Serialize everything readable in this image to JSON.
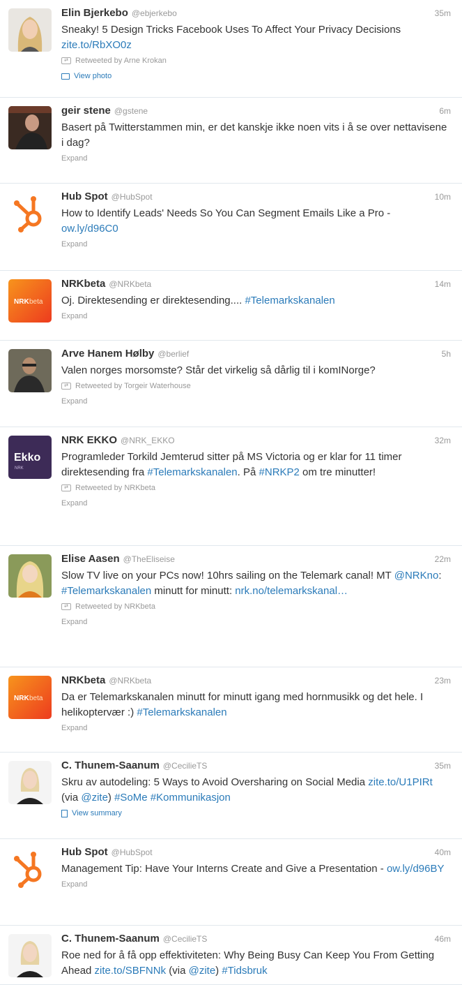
{
  "tweets": [
    {
      "name": "Elin Bjerkebo",
      "handle": "@ebjerkebo",
      "time": "35m",
      "avatar": "woman-blonde",
      "segments": [
        {
          "t": "Sneaky! 5 Design Tricks Facebook Uses To Affect Your Privacy Decisions ",
          "k": "text"
        },
        {
          "t": "zite.to/RbXO0z",
          "k": "link"
        }
      ],
      "retweeted_by": "Retweeted by Arne Krokan",
      "action": "View photo",
      "action_type": "photo"
    },
    {
      "name": "geir stene",
      "handle": "@gstene",
      "time": "6m",
      "avatar": "man-dark",
      "segments": [
        {
          "t": "Basert på Twitterstammen min, er det kanskje ikke noen vits i å se over nettavisene i dag?",
          "k": "text"
        }
      ],
      "action": "Expand",
      "action_type": "expand"
    },
    {
      "name": "Hub Spot",
      "handle": "@HubSpot",
      "time": "10m",
      "avatar": "hubspot",
      "segments": [
        {
          "t": "How to Identify Leads' Needs So You Can Segment Emails Like a Pro - ",
          "k": "text"
        },
        {
          "t": "ow.ly/d96C0",
          "k": "link"
        }
      ],
      "action": "Expand",
      "action_type": "expand"
    },
    {
      "name": "NRKbeta",
      "handle": "@NRKbeta",
      "time": "14m",
      "avatar": "nrkbeta",
      "segments": [
        {
          "t": "Oj. Direktesending er direktesending.... ",
          "k": "text"
        },
        {
          "t": "#Telemarkskanalen",
          "k": "tag"
        }
      ],
      "action": "Expand",
      "action_type": "expand"
    },
    {
      "name": "Arve Hanem Hølby",
      "handle": "@berlief",
      "time": "5h",
      "avatar": "man-glasses",
      "segments": [
        {
          "t": "Valen norges morsomste? Står det virkelig så dårlig til i komINorge?",
          "k": "text"
        }
      ],
      "retweeted_by": "Retweeted by Torgeir Waterhouse",
      "action": "Expand",
      "action_type": "expand"
    },
    {
      "name": "NRK EKKO",
      "handle": "@NRK_EKKO",
      "time": "32m",
      "avatar": "ekko",
      "segments": [
        {
          "t": "Programleder Torkild Jemterud sitter på MS Victoria og er klar for 11 timer direktesending fra ",
          "k": "text"
        },
        {
          "t": "#Telemarkskanalen",
          "k": "tag"
        },
        {
          "t": ". På ",
          "k": "text"
        },
        {
          "t": "#NRKP2",
          "k": "tag"
        },
        {
          "t": " om tre minutter!",
          "k": "text"
        }
      ],
      "retweeted_by": "Retweeted by NRKbeta",
      "action": "Expand",
      "action_type": "expand"
    },
    {
      "name": "Elise Aasen",
      "handle": "@TheEliseise",
      "time": "22m",
      "avatar": "woman-light",
      "segments": [
        {
          "t": "Slow TV live on your PCs now! 10hrs sailing on the Telemark canal! MT ",
          "k": "text"
        },
        {
          "t": "@NRKno",
          "k": "link"
        },
        {
          "t": ": ",
          "k": "text"
        },
        {
          "t": "#Telemarkskanalen",
          "k": "tag"
        },
        {
          "t": " minutt for minutt: ",
          "k": "text"
        },
        {
          "t": "nrk.no/telemarkskanal…",
          "k": "link"
        }
      ],
      "retweeted_by": "Retweeted by NRKbeta",
      "action": "Expand",
      "action_type": "expand"
    },
    {
      "name": "NRKbeta",
      "handle": "@NRKbeta",
      "time": "23m",
      "avatar": "nrkbeta",
      "segments": [
        {
          "t": "Da er Telemarkskanalen minutt for minutt igang med hornmusikk og det hele. I helikoptervær :) ",
          "k": "text"
        },
        {
          "t": "#Telemarkskanalen",
          "k": "tag"
        }
      ],
      "action": "Expand",
      "action_type": "expand"
    },
    {
      "name": "C. Thunem-Saanum",
      "handle": "@CecilieTS",
      "time": "35m",
      "avatar": "woman-blonde2",
      "segments": [
        {
          "t": "Skru av autodeling: 5 Ways to Avoid Oversharing on Social Media ",
          "k": "text"
        },
        {
          "t": "zite.to/U1PIRt",
          "k": "link"
        },
        {
          "t": " (via ",
          "k": "text"
        },
        {
          "t": "@zite",
          "k": "link"
        },
        {
          "t": ") ",
          "k": "text"
        },
        {
          "t": "#SoMe",
          "k": "tag"
        },
        {
          "t": " ",
          "k": "text"
        },
        {
          "t": "#Kommunikasjon",
          "k": "tag"
        }
      ],
      "action": "View summary",
      "action_type": "summary"
    },
    {
      "name": "Hub Spot",
      "handle": "@HubSpot",
      "time": "40m",
      "avatar": "hubspot",
      "segments": [
        {
          "t": "Management Tip: Have Your Interns Create and Give a Presentation - ",
          "k": "text"
        },
        {
          "t": "ow.ly/d96BY",
          "k": "link"
        }
      ],
      "action": "Expand",
      "action_type": "expand"
    },
    {
      "name": "C. Thunem-Saanum",
      "handle": "@CecilieTS",
      "time": "46m",
      "avatar": "woman-blonde2",
      "segments": [
        {
          "t": "Roe ned for å få opp effektiviteten: Why Being Busy Can Keep You From Getting Ahead ",
          "k": "text"
        },
        {
          "t": "zite.to/SBFNNk",
          "k": "link"
        },
        {
          "t": " (via ",
          "k": "text"
        },
        {
          "t": "@zite",
          "k": "link"
        },
        {
          "t": ") ",
          "k": "text"
        },
        {
          "t": "#Tidsbruk",
          "k": "tag"
        }
      ]
    }
  ],
  "colors": {
    "link": "#2b7bb9",
    "meta": "#999999",
    "name": "#333333",
    "hubspot": "#f57722",
    "nrkbeta": "#f26522",
    "ekko": "#3d2b57"
  }
}
